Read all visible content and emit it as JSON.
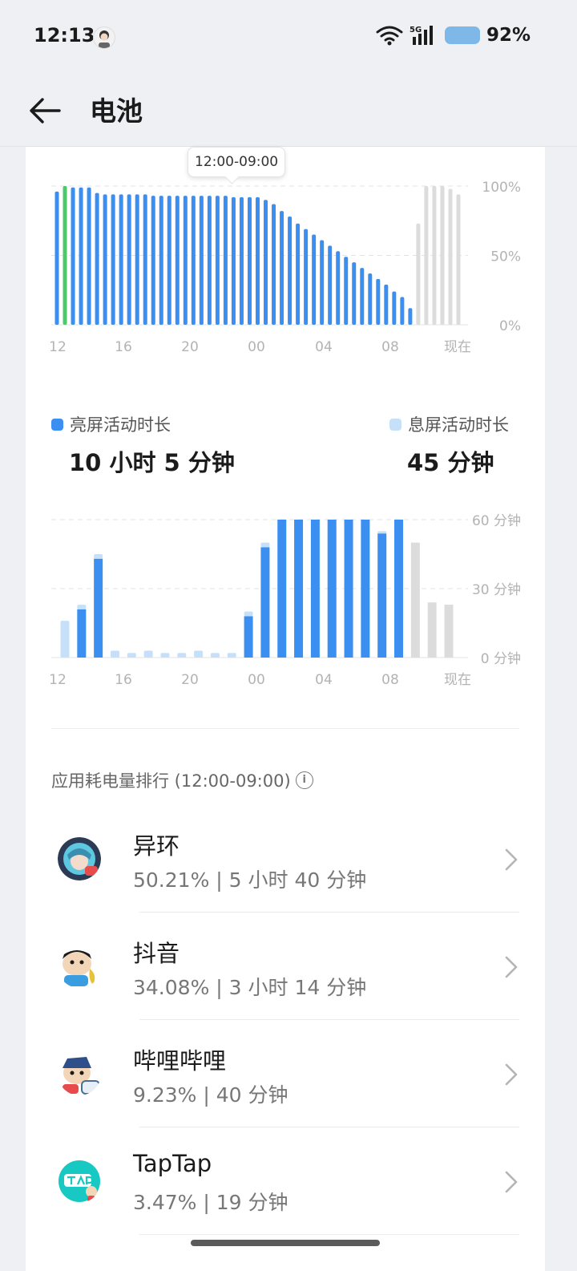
{
  "status_bar": {
    "time": "12:13",
    "network": "5G",
    "battery_percent": "92%"
  },
  "header": {
    "title": "电池"
  },
  "level_chart": {
    "tooltip": "12:00-09:00",
    "chart_data": {
      "type": "bar",
      "title": "",
      "x_tick_labels": [
        "12",
        "16",
        "20",
        "00",
        "04",
        "08",
        "现在"
      ],
      "y_tick_labels": [
        "100%",
        "50%",
        "0%"
      ],
      "ylim": [
        0,
        100
      ],
      "grid": true,
      "series": [
        {
          "values": [
            96,
            100,
            99,
            99,
            99,
            95,
            94,
            94,
            94,
            94,
            94,
            94,
            93,
            93,
            93,
            93,
            93,
            93,
            93,
            93,
            93,
            93,
            92,
            92,
            92,
            92,
            90,
            87,
            82,
            78,
            73,
            69,
            65,
            61,
            57,
            53,
            49,
            45,
            41,
            37,
            33,
            29,
            24,
            20,
            12
          ]
        },
        {
          "values": [
            73,
            100,
            100,
            100,
            98,
            94
          ]
        }
      ],
      "colors": {
        "used": "#3b8ff0",
        "charging": "#4cc96a",
        "forecast": "#dcdcdc"
      },
      "charging_index": 1
    }
  },
  "legend": {
    "screen_on": {
      "label": "亮屏活动时长",
      "value": "10 小时 5 分钟",
      "color": "#3b8ff0"
    },
    "screen_off": {
      "label": "息屏活动时长",
      "value": "45 分钟",
      "color": "#c6e0f9"
    }
  },
  "activity_chart": {
    "chart_data": {
      "type": "bar",
      "title": "",
      "x_tick_labels": [
        "12",
        "16",
        "20",
        "00",
        "04",
        "08",
        "现在"
      ],
      "y_tick_labels": [
        "60 分钟",
        "30 分钟",
        "0 分钟"
      ],
      "ylim": [
        0,
        60
      ],
      "grid": true,
      "series": [
        {
          "name": "亮屏活动时长",
          "values": [
            0,
            21,
            43,
            0,
            0,
            0,
            0,
            0,
            0,
            0,
            0,
            18,
            48,
            60,
            60,
            60,
            60,
            60,
            60,
            54,
            60
          ]
        },
        {
          "name": "息屏活动时长",
          "values": [
            16,
            2,
            2,
            3,
            2,
            3,
            2,
            2,
            3,
            2,
            2,
            2,
            2,
            0,
            0,
            0,
            0,
            0,
            0,
            1,
            0
          ]
        }
      ],
      "forecast_values": [
        50,
        24,
        23
      ],
      "colors": {
        "screen_on": "#3b8ff0",
        "screen_off": "#c6e0f9",
        "forecast": "#dcdcdc"
      }
    }
  },
  "ranking": {
    "title": "应用耗电量排行 (12:00-09:00)",
    "apps": [
      {
        "name": "异环",
        "stat": "50.21% | 5 小时 40 分钟",
        "icon": "yihuan-app-icon"
      },
      {
        "name": "抖音",
        "stat": "34.08% | 3 小时 14 分钟",
        "icon": "douyin-app-icon"
      },
      {
        "name": "哔哩哔哩",
        "stat": "9.23% | 40 分钟",
        "icon": "bilibili-app-icon"
      },
      {
        "name": "TapTap",
        "stat": "3.47% | 19 分钟",
        "icon": "taptap-app-icon"
      }
    ]
  }
}
